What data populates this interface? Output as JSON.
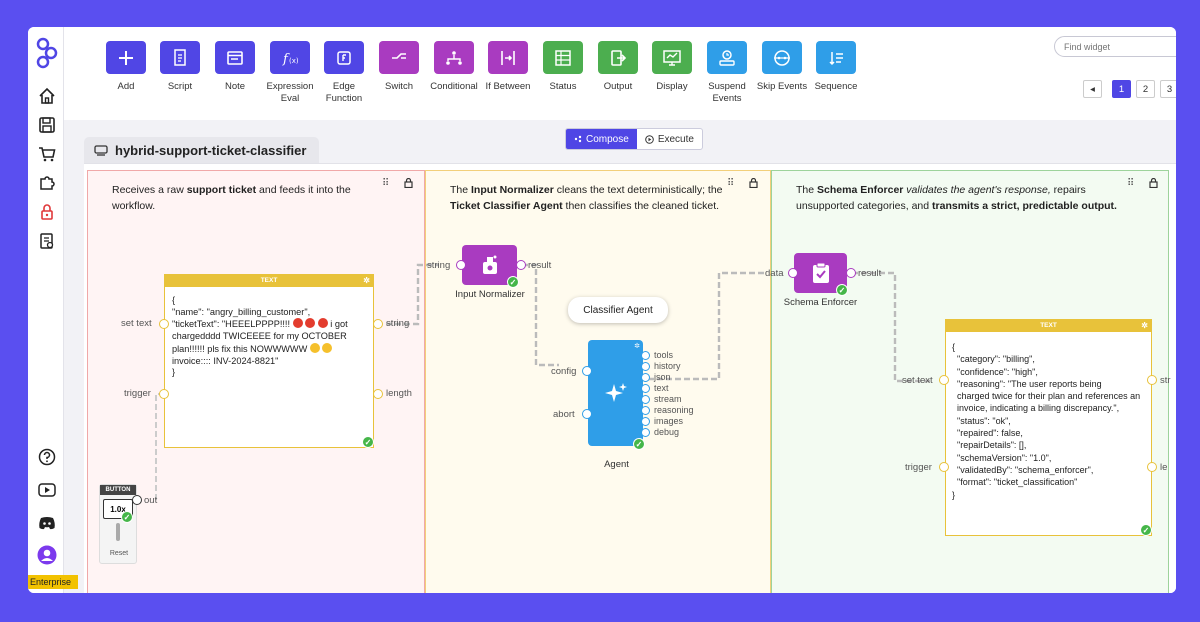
{
  "app": {
    "enterprise_label": "Enterprise"
  },
  "sidebar": {
    "icons": [
      "logo-icon",
      "home-icon",
      "save-icon",
      "cart-icon",
      "puzzle-icon",
      "lock-icon",
      "book-icon"
    ],
    "bottom_icons": [
      "help-icon",
      "youtube-icon",
      "discord-icon",
      "avatar-icon"
    ]
  },
  "toolbar": {
    "tools": [
      {
        "name": "add",
        "label": "Add",
        "color": "#5046e5",
        "icon": "plus-icon"
      },
      {
        "name": "script",
        "label": "Script",
        "color": "#5046e5",
        "icon": "script-icon"
      },
      {
        "name": "note",
        "label": "Note",
        "color": "#5046e5",
        "icon": "note-icon"
      },
      {
        "name": "expression-eval",
        "label": "Expression Eval",
        "color": "#5046e5",
        "icon": "function-icon"
      },
      {
        "name": "edge-function",
        "label": "Edge Function",
        "color": "#5046e5",
        "icon": "edge-function-icon"
      },
      {
        "name": "switch",
        "label": "Switch",
        "color": "#a93bc0",
        "icon": "switch-icon"
      },
      {
        "name": "conditional",
        "label": "Conditional",
        "color": "#a93bc0",
        "icon": "conditional-icon"
      },
      {
        "name": "if-between",
        "label": "If Between",
        "color": "#a93bc0",
        "icon": "if-between-icon"
      },
      {
        "name": "status",
        "label": "Status",
        "color": "#4cae4f",
        "icon": "status-icon"
      },
      {
        "name": "output",
        "label": "Output",
        "color": "#4cae4f",
        "icon": "output-icon"
      },
      {
        "name": "display",
        "label": "Display",
        "color": "#4cae4f",
        "icon": "display-icon"
      },
      {
        "name": "suspend-events",
        "label": "Suspend Events",
        "color": "#2f9ee8",
        "icon": "suspend-icon"
      },
      {
        "name": "skip-events",
        "label": "Skip Events",
        "color": "#2f9ee8",
        "icon": "skip-icon"
      },
      {
        "name": "sequence",
        "label": "Sequence",
        "color": "#2f9ee8",
        "icon": "sequence-icon"
      }
    ],
    "search_placeholder": "Find widget",
    "pages": [
      "1",
      "2",
      "3"
    ],
    "prev": "◂",
    "next": "▸"
  },
  "workflow": {
    "title": "hybrid-support-ticket-classifier",
    "modes": {
      "compose": "Compose",
      "execute": "Execute"
    }
  },
  "colors": {
    "panel1_border": "#f0a8a8",
    "panel1_bg": "#fff4f4",
    "panel2_border": "#f2cf7a",
    "panel2_bg": "#fffbee",
    "panel3_border": "#9dd39b",
    "panel3_bg": "#f3fbf2",
    "purple": "#a93bc0",
    "blue": "#2f9ee8",
    "yellow": "#e8c23a",
    "green": "#45b649"
  },
  "panels": {
    "p1": {
      "desc_a": "Receives a raw ",
      "desc_b": "support ticket",
      "desc_c": " and feeds it into the workflow."
    },
    "p2": {
      "desc_a": "The ",
      "desc_b": "Input Normalizer",
      "desc_c": " cleans the text deterministically; the ",
      "desc_d": "Ticket Classifier Agent",
      "desc_e": " then classifies the cleaned ticket."
    },
    "p3": {
      "desc_a": "The ",
      "desc_b": "Schema Enforcer",
      "desc_c": " validates the agent's response,",
      "desc_d": " repairs unsupported categories, and ",
      "desc_e": "transmits a strict, predictable output."
    }
  },
  "text_node_1": {
    "header": "TEXT",
    "line1": "{",
    "line2": "\"name\": \"angry_billing_customer\",",
    "line3": "\"ticketText\": \"HEEELPPPP!!!! ",
    "line3b": " i got",
    "line4": "chargedddd TWICEEEE for my OCTOBER",
    "line5": "plan!!!!!! pls fix this NOWWWWW ",
    "line6": "invoice:::: INV-2024-8821\"",
    "line7": "}",
    "port_set_text": "set text",
    "port_trigger": "trigger",
    "port_string": "string",
    "port_length": "length"
  },
  "button_node": {
    "header": "BUTTON",
    "value": "1.0x",
    "port_out": "out",
    "reset": "Reset"
  },
  "input_normalizer": {
    "label": "Input Normalizer",
    "port_in": "string",
    "port_out": "result"
  },
  "agent": {
    "tooltip": "Classifier Agent",
    "label": "Agent",
    "port_config": "config",
    "port_abort": "abort",
    "outputs": [
      "tools",
      "history",
      "json",
      "text",
      "stream",
      "reasoning",
      "images",
      "debug"
    ]
  },
  "schema_enforcer": {
    "label": "Schema Enforcer",
    "port_in": "data",
    "port_out": "result"
  },
  "text_node_2": {
    "header": "TEXT",
    "lines": [
      "{",
      "  \"category\": \"billing\",",
      "  \"confidence\": \"high\",",
      "  \"reasoning\": \"The user reports being",
      "  charged twice for their plan and references an",
      "  invoice, indicating a billing discrepancy.\",",
      "  \"status\": \"ok\",",
      "  \"repaired\": false,",
      "  \"repairDetails\": [],",
      "  \"schemaVersion\": \"1.0\",",
      "  \"validatedBy\": \"schema_enforcer\",",
      "  \"format\": \"ticket_classification\"",
      "}"
    ],
    "port_set_text": "set text",
    "port_trigger": "trigger",
    "port_str": "str",
    "port_le": "le"
  }
}
